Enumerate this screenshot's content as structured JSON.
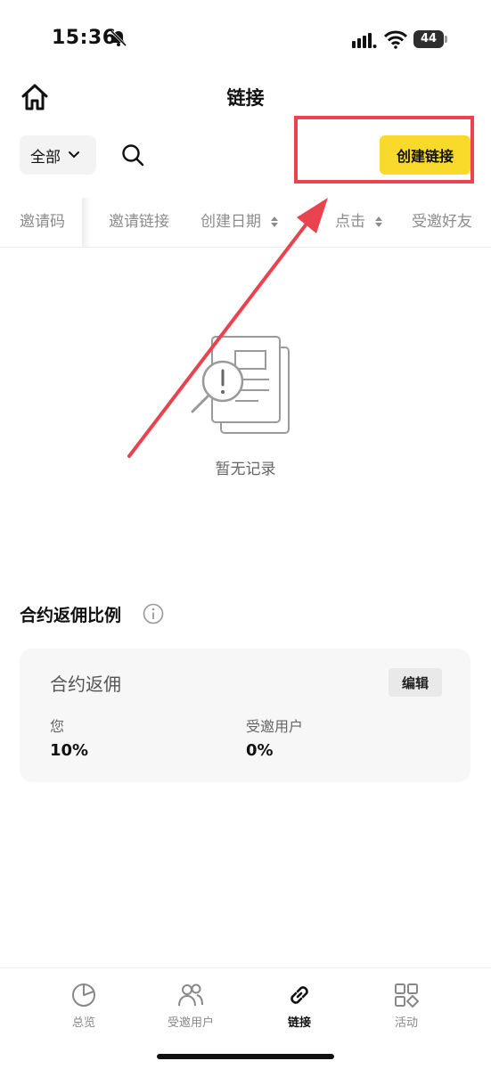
{
  "status_bar": {
    "time": "15:36",
    "battery": "44"
  },
  "header": {
    "title": "链接"
  },
  "toolbar": {
    "filter_label": "全部",
    "create_button_label": "创建链接"
  },
  "table": {
    "columns": [
      "邀请码",
      "邀请链接",
      "创建日期",
      "点击",
      "受邀好友"
    ]
  },
  "empty_state": {
    "text": "暂无记录"
  },
  "rebate_section": {
    "title": "合约返佣比例",
    "card_title": "合约返佣",
    "edit_label": "编辑",
    "you_label": "您",
    "you_value": "10%",
    "invited_label": "受邀用户",
    "invited_value": "0%"
  },
  "bottom_nav": {
    "items": [
      {
        "label": "总览",
        "icon": "pie-chart-icon"
      },
      {
        "label": "受邀用户",
        "icon": "users-icon"
      },
      {
        "label": "链接",
        "icon": "link-icon",
        "active": true
      },
      {
        "label": "活动",
        "icon": "grid-icon"
      }
    ]
  },
  "colors": {
    "accent": "#f9d92a",
    "annotation": "#e8434f"
  }
}
